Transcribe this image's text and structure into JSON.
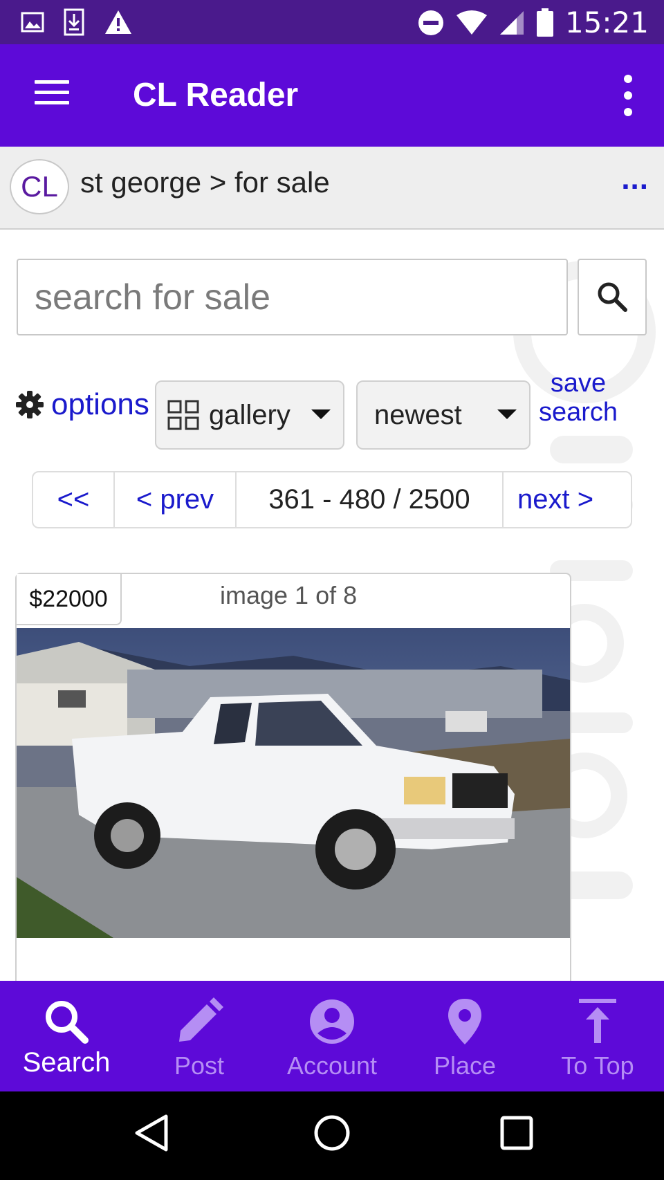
{
  "status_bar": {
    "time": "15:21",
    "left_icons": [
      "image-icon",
      "download-icon",
      "warning-icon"
    ],
    "right_icons": [
      "do-not-disturb-icon",
      "wifi-icon",
      "signal-icon",
      "battery-icon"
    ]
  },
  "app_bar": {
    "title": "CL Reader",
    "menu_icon": "hamburger-menu-icon",
    "overflow_icon": "more-vert-icon"
  },
  "breadcrumb": {
    "logo_text": "CL",
    "path": "st george > for sale",
    "more": "..."
  },
  "search": {
    "placeholder": "search for sale",
    "value": "",
    "button_icon": "search-icon"
  },
  "toolbar": {
    "options_label": "options",
    "view_select": "gallery",
    "sort_select": "newest",
    "save_search_label": "save search"
  },
  "pagination": {
    "first": "<<",
    "prev": "< prev",
    "range": "361 - 480 / 2500",
    "next": "next >"
  },
  "listing": {
    "price": "$22000",
    "image_counter": "image 1 of 8"
  },
  "bottom_nav": {
    "items": [
      {
        "label": "Search",
        "icon": "search-icon",
        "active": true
      },
      {
        "label": "Post",
        "icon": "pencil-icon",
        "active": false
      },
      {
        "label": "Account",
        "icon": "account-circle-icon",
        "active": false
      },
      {
        "label": "Place",
        "icon": "location-pin-icon",
        "active": false
      },
      {
        "label": "To Top",
        "icon": "arrow-up-to-top-icon",
        "active": false
      }
    ]
  },
  "system_nav": [
    "back-icon",
    "home-icon",
    "recents-icon"
  ],
  "colors": {
    "status_bar": "#4a1a8c",
    "app_bar": "#5d0ad8",
    "link": "#1a1acc",
    "nav_inactive": "#b58ef4"
  }
}
